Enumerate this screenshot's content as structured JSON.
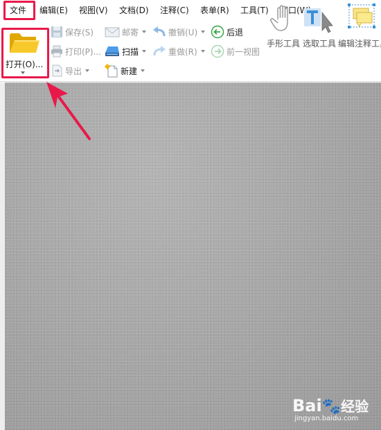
{
  "menu": {
    "items": [
      {
        "label": "文件"
      },
      {
        "label": "编辑(E)"
      },
      {
        "label": "视图(V)"
      },
      {
        "label": "文档(D)"
      },
      {
        "label": "注释(C)"
      },
      {
        "label": "表单(R)"
      },
      {
        "label": "工具(T)"
      },
      {
        "label": "窗口(W)"
      }
    ]
  },
  "toolbar": {
    "open": {
      "label": "打开(O)..."
    },
    "save": {
      "label": "保存(S)"
    },
    "print": {
      "label": "打印(P)..."
    },
    "export": {
      "label": "导出"
    },
    "email": {
      "label": "邮寄"
    },
    "scan": {
      "label": "扫描"
    },
    "new": {
      "label": "新建"
    },
    "undo": {
      "label": "撤销(U)"
    },
    "redo": {
      "label": "重做(R)"
    },
    "back": {
      "label": "后退"
    },
    "forward": {
      "label": "前一视图"
    },
    "hand_tool": {
      "label": "手形工具"
    },
    "select_tool": {
      "label": "选取工具"
    },
    "annot_tool": {
      "label": "编辑注释工具"
    }
  },
  "colors": {
    "highlight": "#e8194a",
    "folder": "#f5c518",
    "nav_green": "#3aa54a",
    "undo_blue": "#3b8fd9",
    "doc_background": "#a7a7a7"
  },
  "watermark": {
    "logo": "Bai",
    "logo_cn": "经验",
    "url": "jingyan.baidu.com"
  }
}
